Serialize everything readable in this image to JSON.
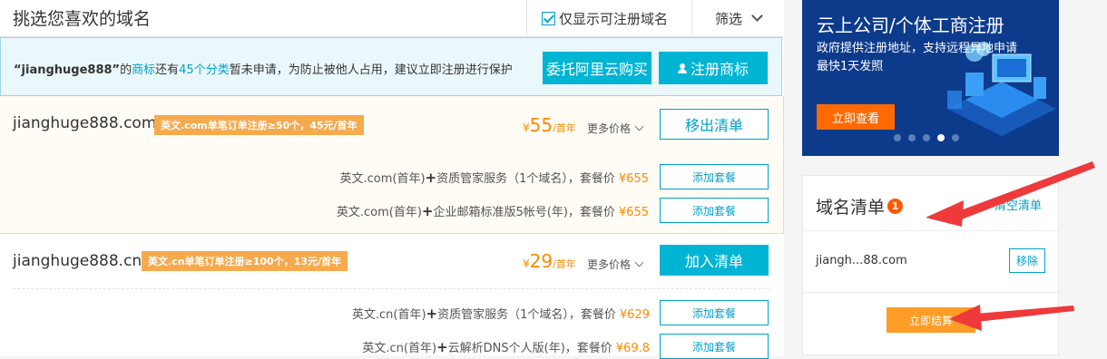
{
  "header": {
    "title": "挑选您喜欢的域名",
    "only_available_label": "仅显示可注册域名",
    "only_available_checked": true,
    "filter_label": "筛选"
  },
  "notice": {
    "prefix": "“jianghuge888”",
    "t1": "的",
    "trademark": "商标",
    "t2": "还有",
    "categories": "45个分类",
    "t3": "暂未申请，为防止被他人占用，建议立即注册进行保护",
    "delegate_button": "委托阿里云购买",
    "register_button": "注册商标"
  },
  "domains": [
    {
      "name": "jianghuge888.com",
      "promo": "英文.com单笔订单注册≥50个，45元/首年",
      "currency": "¥",
      "price": "55",
      "unit": "/首年",
      "more": "更多价格",
      "action": "移出清单",
      "packages": [
        {
          "text": "英文.com(首年)",
          "plus": "+",
          "service": "资质管家服务（1个域名），套餐价",
          "price": "¥655",
          "button": "添加套餐"
        },
        {
          "text": "英文.com(首年)",
          "plus": "+",
          "service": "企业邮箱标准版5帐号(年)，套餐价",
          "price": "¥655",
          "button": "添加套餐"
        }
      ]
    },
    {
      "name": "jianghuge888.cn",
      "promo": "英文.cn单笔订单注册≥100个，13元/首年",
      "currency": "¥",
      "price": "29",
      "unit": "/首年",
      "more": "更多价格",
      "action": "加入清单",
      "packages": [
        {
          "text": "英文.cn(首年)",
          "plus": "+",
          "service": "资质管家服务（1个域名），套餐价",
          "price": "¥629",
          "button": "添加套餐"
        },
        {
          "text": "英文.cn(首年)",
          "plus": "+",
          "service": "云解析DNS个人版(年)，套餐价",
          "price": "¥69.8",
          "button": "添加套餐"
        }
      ]
    }
  ],
  "ad": {
    "title": "云上公司/个体工商注册",
    "subtitle_line1": "政府提供注册地址，支持远程异地申请",
    "subtitle_line2": "最快1天发照",
    "button": "立即查看",
    "dots": 5,
    "active_dot": 4
  },
  "cart": {
    "title": "域名清单",
    "count": "1",
    "clear": "清空清单",
    "item": "jiangh...88.com",
    "remove": "移除",
    "checkout": "立即结算"
  },
  "colors": {
    "accent": "#00b4d4",
    "link": "#00a2ca",
    "price": "#ff8a00",
    "promo": "#f6a94d",
    "arrow": "#ee3a3a",
    "ad_bg": "#0d3b8c"
  }
}
